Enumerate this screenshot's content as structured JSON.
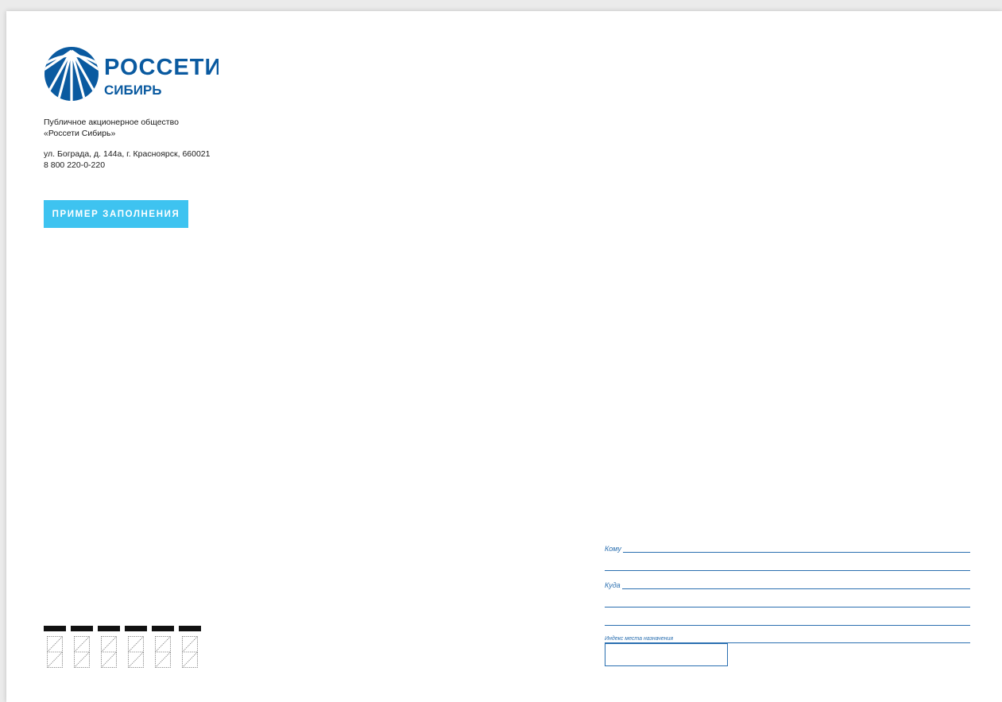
{
  "logo": {
    "brand_name": "РОССЕТИ",
    "subsidiary": "СИБИРЬ",
    "color": "#0a5aa0"
  },
  "company": {
    "legal_line1": "Публичное акционерное общество",
    "legal_line2": "«Россети Сибирь»",
    "address": "ул. Бограда, д. 144а, г. Красноярск, 660021",
    "phone": "8 800 220-0-220"
  },
  "badge": {
    "label": "ПРИМЕР ЗАПОЛНЕНИЯ",
    "color": "#3ec3f0"
  },
  "recipient": {
    "to_label": "Кому",
    "where_label": "Куда",
    "index_label": "Индекс места назначения",
    "line_color": "#2a6fb0"
  },
  "postcode": {
    "digit_count": 6
  }
}
